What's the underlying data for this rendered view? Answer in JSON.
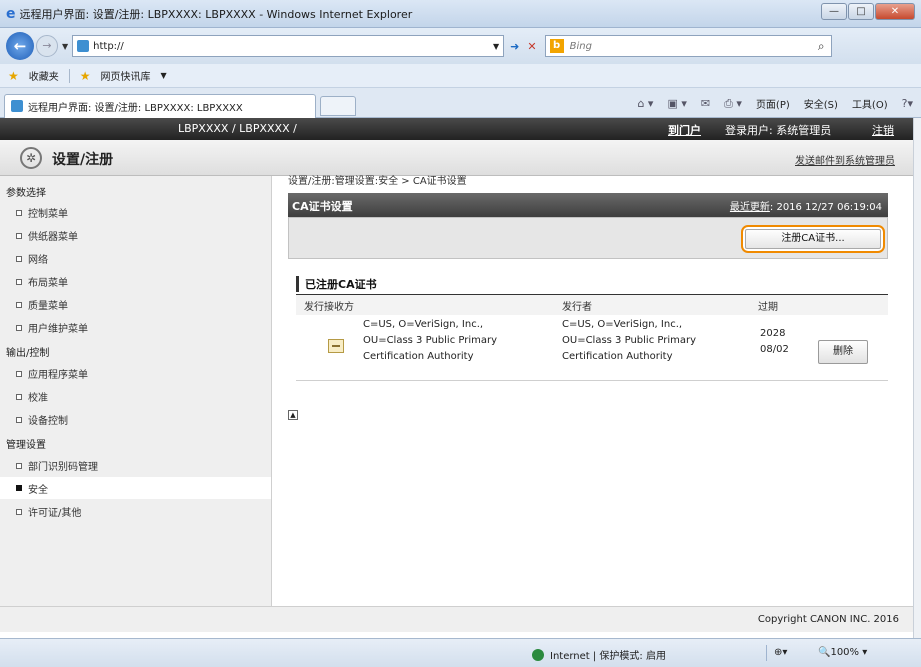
{
  "window": {
    "title": "远程用户界面: 设置/注册: LBPXXXX: LBPXXXX - Windows Internet Explorer",
    "url": "http://",
    "search_placeholder": "Bing"
  },
  "favorites": {
    "label": "收藏夹",
    "feed": "网页快讯库"
  },
  "tab": {
    "label": "远程用户界面: 设置/注册: LBPXXXX: LBPXXXX"
  },
  "command_bar": {
    "page": "页面(P)",
    "safety": "安全(S)",
    "tools": "工具(O)"
  },
  "topbar": {
    "device": "LBPXXXX / LBPXXXX /",
    "portal": "到门户",
    "user": "登录用户: 系统管理员",
    "logout": "注销"
  },
  "header": {
    "title": "设置/注册",
    "mail_link": "发送邮件到系统管理员"
  },
  "sidebar": {
    "sections": [
      {
        "title": "参数选择",
        "items": [
          "控制菜单",
          "供纸器菜单",
          "网络",
          "布局菜单",
          "质量菜单",
          "用户维护菜单"
        ]
      },
      {
        "title": "输出/控制",
        "items": [
          "应用程序菜单",
          "校准",
          "设备控制"
        ]
      },
      {
        "title": "管理设置",
        "items": [
          "部门识别码管理",
          "安全",
          "许可证/其他"
        ]
      }
    ],
    "active": "安全"
  },
  "main": {
    "breadcrumb": "设置/注册:管理设置:安全 > CA证书设置",
    "panel_title": "CA证书设置",
    "last_updated_label": "最近更新",
    "last_updated_value": ": 2016 12/27 06:19:04",
    "register_button": "注册CA证书...",
    "section_title": "已注册CA证书",
    "columns": [
      "发行接收方",
      "发行者",
      "过期"
    ],
    "rows": [
      {
        "issued_to": [
          "C=US, O=VeriSign, Inc.,",
          "OU=Class 3 Public Primary",
          "Certification Authority"
        ],
        "issuer": [
          "C=US, O=VeriSign, Inc.,",
          "OU=Class 3 Public Primary",
          "Certification Authority"
        ],
        "expiry": [
          "2028",
          "08/02"
        ],
        "delete_label": "删除"
      }
    ]
  },
  "footer": {
    "copyright": "Copyright CANON INC. 2016"
  },
  "status": {
    "zone": "Internet | 保护模式: 启用",
    "zoom": "100%"
  },
  "colors": {
    "highlight": "#f08a00",
    "dark_bar": "#333333"
  }
}
